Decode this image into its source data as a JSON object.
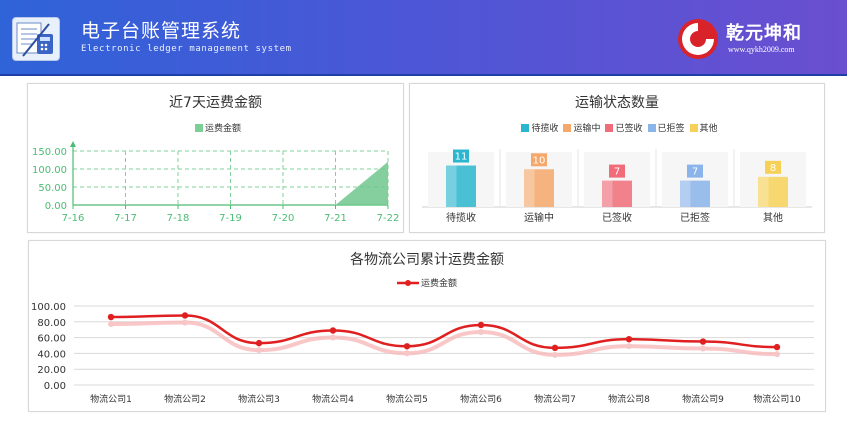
{
  "header": {
    "title": "电子台账管理系统",
    "subtitle": "Electronic ledger management system",
    "brand_name": "乾元坤和",
    "brand_url": "www.qykh2009.com"
  },
  "colors": {
    "header_bg": "#3a5fd8",
    "green": "#4cbc73",
    "red": "#e02020"
  },
  "panels": {
    "freight7": {
      "title": "近7天运费金额",
      "legend": "运费金额"
    },
    "status": {
      "title": "运输状态数量"
    },
    "cumulative": {
      "title": "各物流公司累计运费金额",
      "legend": "运费金额"
    }
  },
  "chart_data": [
    {
      "type": "area",
      "title": "近7天运费金额",
      "x": [
        "7-16",
        "7-17",
        "7-18",
        "7-19",
        "7-20",
        "7-21",
        "7-22"
      ],
      "series": [
        {
          "name": "运费金额",
          "values": [
            0,
            0,
            0,
            0,
            0,
            0,
            120
          ]
        }
      ],
      "yticks": [
        "0.00",
        "50.00",
        "100.00",
        "150.00"
      ],
      "ylim": [
        0,
        150
      ],
      "grid": true,
      "legend": "top"
    },
    {
      "type": "bar",
      "title": "运输状态数量",
      "categories": [
        "待揽收",
        "运输中",
        "已签收",
        "已拒签",
        "其他"
      ],
      "values": [
        11,
        10,
        7,
        7,
        8
      ],
      "colors": [
        "#2bb6cf",
        "#f5a86a",
        "#f06c78",
        "#8ab4ea",
        "#f7d157"
      ],
      "legend": "top"
    },
    {
      "type": "line",
      "title": "各物流公司累计运费金额",
      "categories": [
        "物流公司1",
        "物流公司2",
        "物流公司3",
        "物流公司4",
        "物流公司5",
        "物流公司6",
        "物流公司7",
        "物流公司8",
        "物流公司9",
        "物流公司10"
      ],
      "series": [
        {
          "name": "运费金额",
          "values": [
            86,
            88,
            53,
            69,
            49,
            76,
            47,
            58,
            55,
            48
          ]
        }
      ],
      "yticks": [
        "0.00",
        "20.00",
        "40.00",
        "60.00",
        "80.00",
        "100.00"
      ],
      "ylim": [
        0,
        100
      ],
      "grid": true,
      "legend": "top"
    }
  ]
}
